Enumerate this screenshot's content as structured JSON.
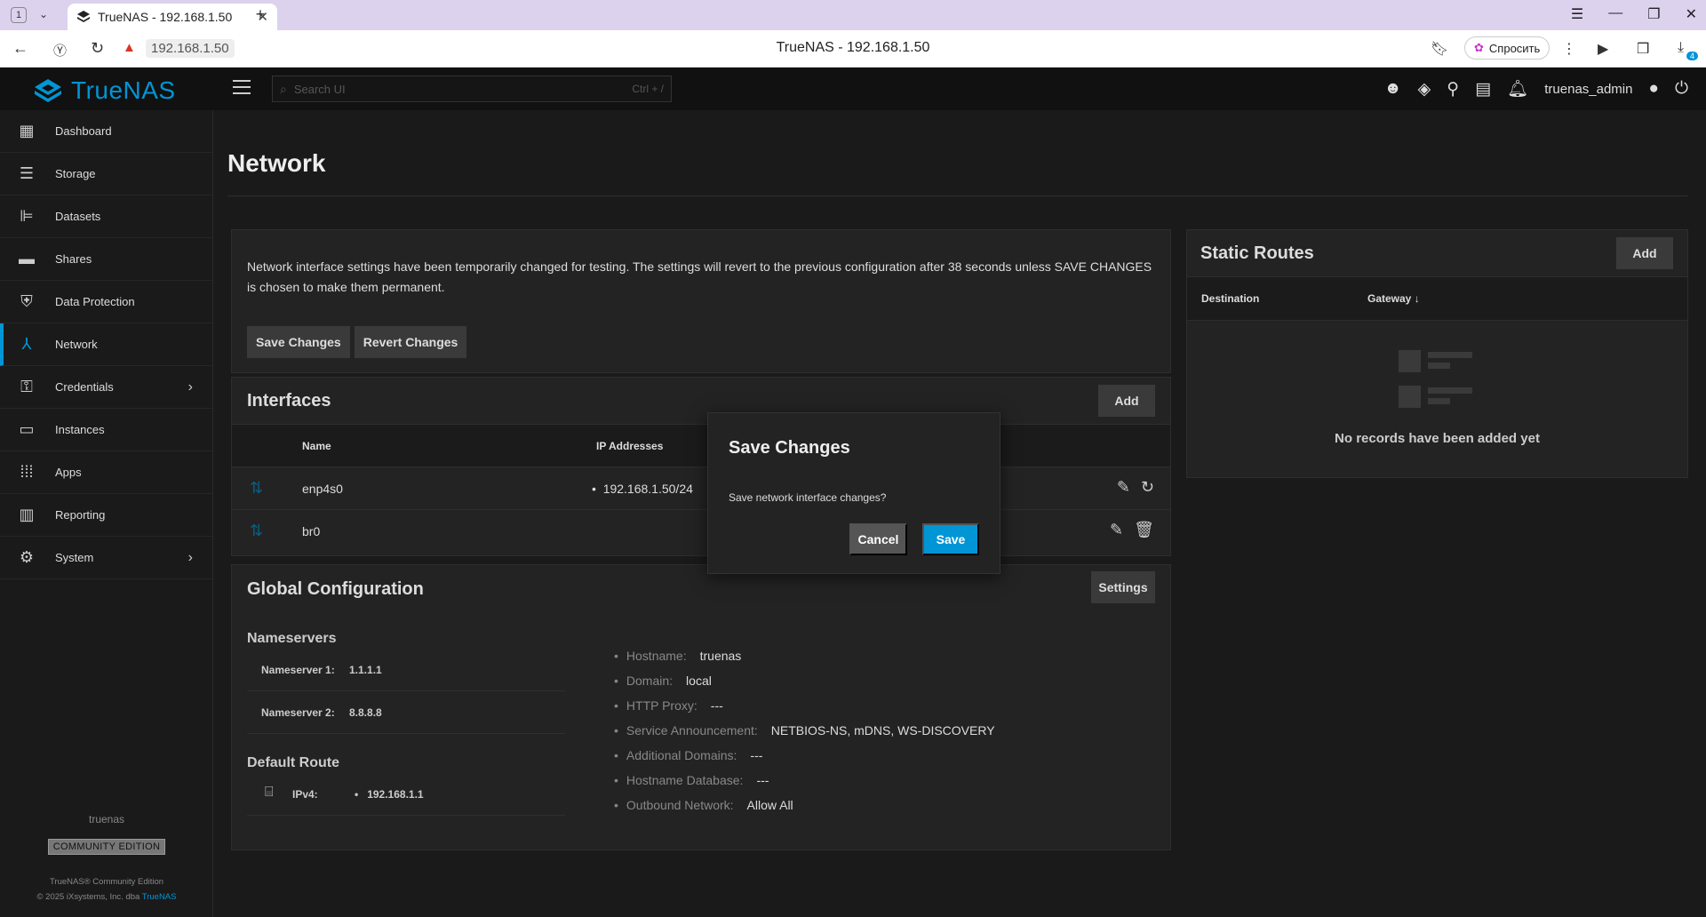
{
  "browser": {
    "tab_count": "1",
    "tab_title": "TrueNAS - 192.168.1.50",
    "url": "192.168.1.50",
    "page_title": "TrueNAS - 192.168.1.50",
    "ask_label": "Спросить",
    "download_badge": "4"
  },
  "header": {
    "logo_text": "TrueNAS",
    "search_placeholder": "Search UI",
    "search_shortcut": "Ctrl + /",
    "username": "truenas_admin"
  },
  "sidebar": {
    "items": [
      {
        "label": "Dashboard",
        "icon": "dashboard-icon"
      },
      {
        "label": "Storage",
        "icon": "storage-icon"
      },
      {
        "label": "Datasets",
        "icon": "datasets-icon"
      },
      {
        "label": "Shares",
        "icon": "shares-icon"
      },
      {
        "label": "Data Protection",
        "icon": "shield-icon"
      },
      {
        "label": "Network",
        "icon": "network-icon"
      },
      {
        "label": "Credentials",
        "icon": "key-icon"
      },
      {
        "label": "Instances",
        "icon": "laptop-icon"
      },
      {
        "label": "Apps",
        "icon": "apps-grid-icon"
      },
      {
        "label": "Reporting",
        "icon": "chart-icon"
      },
      {
        "label": "System",
        "icon": "gear-icon"
      }
    ],
    "active": "Network",
    "hostname": "truenas",
    "edition": "COMMUNITY EDITION",
    "copyright_line1": "TrueNAS® Community Edition",
    "copyright_line2": "© 2025 iXsystems, Inc. dba ",
    "copyright_link": "TrueNAS"
  },
  "main": {
    "title": "Network",
    "notice": {
      "text": "Network interface settings have been temporarily changed for testing. The settings will revert to the previous configuration after 38 seconds unless SAVE CHANGES is chosen to make them permanent.",
      "save_label": "Save Changes",
      "revert_label": "Revert Changes"
    },
    "interfaces": {
      "title": "Interfaces",
      "add_label": "Add",
      "columns": [
        "Name",
        "IP Addresses"
      ],
      "rows": [
        {
          "name": "enp4s0",
          "ip": "192.168.1.50/24"
        },
        {
          "name": "br0",
          "ip": ""
        }
      ]
    },
    "global": {
      "title": "Global Configuration",
      "settings_label": "Settings",
      "nameservers_title": "Nameservers",
      "nameservers": [
        {
          "label": "Nameserver 1:",
          "value": "1.1.1.1"
        },
        {
          "label": "Nameserver 2:",
          "value": "8.8.8.8"
        }
      ],
      "default_route_title": "Default Route",
      "ipv4_label": "IPv4:",
      "ipv4_value": "192.168.1.1",
      "details": [
        {
          "key": "Hostname:",
          "value": "truenas"
        },
        {
          "key": "Domain:",
          "value": "local"
        },
        {
          "key": "HTTP Proxy:",
          "value": "---"
        },
        {
          "key": "Service Announcement:",
          "value": "NETBIOS-NS, mDNS, WS-DISCOVERY"
        },
        {
          "key": "Additional Domains:",
          "value": "---"
        },
        {
          "key": "Hostname Database:",
          "value": "---"
        },
        {
          "key": "Outbound Network:",
          "value": "Allow All"
        }
      ]
    },
    "routes": {
      "title": "Static Routes",
      "add_label": "Add",
      "col_destination": "Destination",
      "col_gateway": "Gateway",
      "empty_text": "No records have been added yet"
    }
  },
  "dialog": {
    "title": "Save Changes",
    "message": "Save network interface changes?",
    "cancel_label": "Cancel",
    "save_label": "Save"
  },
  "colors": {
    "accent": "#0095d5",
    "background": "#1a1a1a",
    "card": "#232323"
  }
}
